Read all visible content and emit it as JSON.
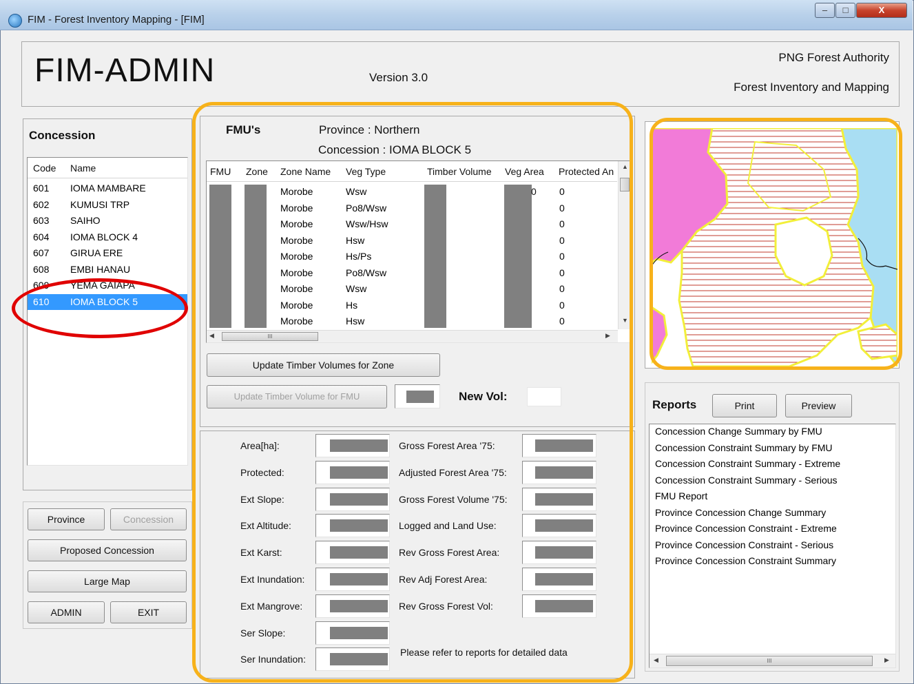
{
  "window": {
    "title": "FIM - Forest Inventory Mapping - [FIM]",
    "min": "–",
    "max": "□",
    "close": "X"
  },
  "header": {
    "app_name": "FIM-ADMIN",
    "version": "Version 3.0",
    "org": "PNG Forest Authority",
    "dept": "Forest Inventory and Mapping"
  },
  "concession": {
    "title": "Concession",
    "col_code": "Code",
    "col_name": "Name",
    "items": [
      {
        "code": "601",
        "name": "IOMA MAMBARE"
      },
      {
        "code": "602",
        "name": "KUMUSI TRP"
      },
      {
        "code": "603",
        "name": "SAIHO"
      },
      {
        "code": "604",
        "name": "IOMA BLOCK 4"
      },
      {
        "code": "607",
        "name": "GIRUA ERE"
      },
      {
        "code": "608",
        "name": "EMBI HANAU"
      },
      {
        "code": "609",
        "name": "YEMA GAIAPA"
      },
      {
        "code": "610",
        "name": "IOMA BLOCK 5"
      }
    ],
    "selected_code": "610"
  },
  "nav_buttons": {
    "province": "Province",
    "concession": "Concession",
    "proposed": "Proposed Concession",
    "large_map": "Large Map",
    "admin": "ADMIN",
    "exit": "EXIT"
  },
  "fmu": {
    "title": "FMU's",
    "province": "Province : Northern",
    "concession": "Concession : IOMA BLOCK 5",
    "columns": [
      "FMU",
      "Zone",
      "Zone Name",
      "Veg Type",
      "Timber Volume",
      "Veg Area",
      "Protected An"
    ],
    "rows": [
      {
        "zone_name": "Morobe",
        "veg_type": "Wsw",
        "protected": "0"
      },
      {
        "zone_name": "Morobe",
        "veg_type": "Po8/Wsw",
        "protected": "0"
      },
      {
        "zone_name": "Morobe",
        "veg_type": "Wsw/Hsw",
        "protected": "0"
      },
      {
        "zone_name": "Morobe",
        "veg_type": "Hsw",
        "protected": "0"
      },
      {
        "zone_name": "Morobe",
        "veg_type": "Hs/Ps",
        "protected": "0"
      },
      {
        "zone_name": "Morobe",
        "veg_type": "Po8/Wsw",
        "protected": "0"
      },
      {
        "zone_name": "Morobe",
        "veg_type": "Wsw",
        "protected": "0"
      },
      {
        "zone_name": "Morobe",
        "veg_type": "Hs",
        "protected": "0"
      },
      {
        "zone_name": "Morobe",
        "veg_type": "Hsw",
        "protected": "0"
      }
    ],
    "veg_area_fragment": "0",
    "scroll_dots": "III",
    "update_zone": "Update Timber Volumes for Zone",
    "update_fmu": "Update Timber Volume for FMU",
    "new_vol_label": "New Vol:"
  },
  "stats": {
    "left": [
      "Area[ha]:",
      "Protected:",
      "Ext Slope:",
      "Ext Altitude:",
      "Ext Karst:",
      "Ext Inundation:",
      "Ext Mangrove:",
      "Ser Slope:",
      "Ser Inundation:"
    ],
    "right": [
      "Gross Forest Area '75:",
      "Adjusted Forest Area '75:",
      "Gross Forest Volume '75:",
      "Logged and Land Use:",
      "Rev Gross Forest Area:",
      "Rev Adj Forest Area:",
      "Rev Gross Forest Vol:"
    ],
    "note": "Please refer to reports for detailed data"
  },
  "reports": {
    "title": "Reports",
    "print": "Print",
    "preview": "Preview",
    "items": [
      "Concession Change Summary by FMU",
      "Concession Constraint  Summary by FMU",
      "Concession Constraint Summary  - Extreme",
      "Concession Constraint Summary  - Serious",
      "FMU Report",
      "Province Concession Change Summary",
      "Province Concession Constraint  - Extreme",
      "Province Concession Constraint  - Serious",
      "Province Concession Constraint  Summary"
    ],
    "scroll_dots": "III"
  },
  "colors": {
    "highlight": "#f7b21b",
    "annotation": "#e00000",
    "selection": "#3399ff",
    "map_pink": "#f27bd8",
    "map_water": "#a9def3",
    "map_boundary": "#f2ef3a",
    "map_hatch": "#c0392b"
  }
}
